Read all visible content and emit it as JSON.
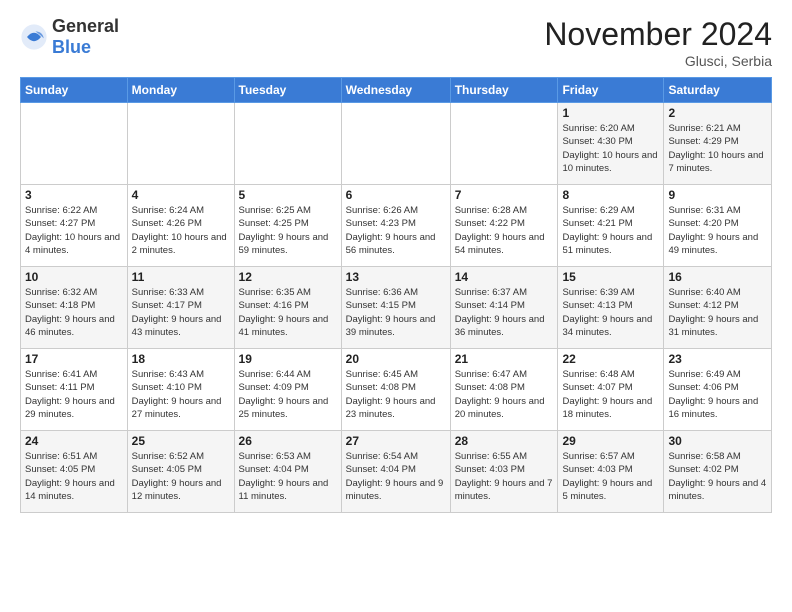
{
  "logo": {
    "general": "General",
    "blue": "Blue"
  },
  "title": "November 2024",
  "location": "Glusci, Serbia",
  "days_of_week": [
    "Sunday",
    "Monday",
    "Tuesday",
    "Wednesday",
    "Thursday",
    "Friday",
    "Saturday"
  ],
  "weeks": [
    [
      {
        "day": "",
        "info": ""
      },
      {
        "day": "",
        "info": ""
      },
      {
        "day": "",
        "info": ""
      },
      {
        "day": "",
        "info": ""
      },
      {
        "day": "",
        "info": ""
      },
      {
        "day": "1",
        "info": "Sunrise: 6:20 AM\nSunset: 4:30 PM\nDaylight: 10 hours and 10 minutes."
      },
      {
        "day": "2",
        "info": "Sunrise: 6:21 AM\nSunset: 4:29 PM\nDaylight: 10 hours and 7 minutes."
      }
    ],
    [
      {
        "day": "3",
        "info": "Sunrise: 6:22 AM\nSunset: 4:27 PM\nDaylight: 10 hours and 4 minutes."
      },
      {
        "day": "4",
        "info": "Sunrise: 6:24 AM\nSunset: 4:26 PM\nDaylight: 10 hours and 2 minutes."
      },
      {
        "day": "5",
        "info": "Sunrise: 6:25 AM\nSunset: 4:25 PM\nDaylight: 9 hours and 59 minutes."
      },
      {
        "day": "6",
        "info": "Sunrise: 6:26 AM\nSunset: 4:23 PM\nDaylight: 9 hours and 56 minutes."
      },
      {
        "day": "7",
        "info": "Sunrise: 6:28 AM\nSunset: 4:22 PM\nDaylight: 9 hours and 54 minutes."
      },
      {
        "day": "8",
        "info": "Sunrise: 6:29 AM\nSunset: 4:21 PM\nDaylight: 9 hours and 51 minutes."
      },
      {
        "day": "9",
        "info": "Sunrise: 6:31 AM\nSunset: 4:20 PM\nDaylight: 9 hours and 49 minutes."
      }
    ],
    [
      {
        "day": "10",
        "info": "Sunrise: 6:32 AM\nSunset: 4:18 PM\nDaylight: 9 hours and 46 minutes."
      },
      {
        "day": "11",
        "info": "Sunrise: 6:33 AM\nSunset: 4:17 PM\nDaylight: 9 hours and 43 minutes."
      },
      {
        "day": "12",
        "info": "Sunrise: 6:35 AM\nSunset: 4:16 PM\nDaylight: 9 hours and 41 minutes."
      },
      {
        "day": "13",
        "info": "Sunrise: 6:36 AM\nSunset: 4:15 PM\nDaylight: 9 hours and 39 minutes."
      },
      {
        "day": "14",
        "info": "Sunrise: 6:37 AM\nSunset: 4:14 PM\nDaylight: 9 hours and 36 minutes."
      },
      {
        "day": "15",
        "info": "Sunrise: 6:39 AM\nSunset: 4:13 PM\nDaylight: 9 hours and 34 minutes."
      },
      {
        "day": "16",
        "info": "Sunrise: 6:40 AM\nSunset: 4:12 PM\nDaylight: 9 hours and 31 minutes."
      }
    ],
    [
      {
        "day": "17",
        "info": "Sunrise: 6:41 AM\nSunset: 4:11 PM\nDaylight: 9 hours and 29 minutes."
      },
      {
        "day": "18",
        "info": "Sunrise: 6:43 AM\nSunset: 4:10 PM\nDaylight: 9 hours and 27 minutes."
      },
      {
        "day": "19",
        "info": "Sunrise: 6:44 AM\nSunset: 4:09 PM\nDaylight: 9 hours and 25 minutes."
      },
      {
        "day": "20",
        "info": "Sunrise: 6:45 AM\nSunset: 4:08 PM\nDaylight: 9 hours and 23 minutes."
      },
      {
        "day": "21",
        "info": "Sunrise: 6:47 AM\nSunset: 4:08 PM\nDaylight: 9 hours and 20 minutes."
      },
      {
        "day": "22",
        "info": "Sunrise: 6:48 AM\nSunset: 4:07 PM\nDaylight: 9 hours and 18 minutes."
      },
      {
        "day": "23",
        "info": "Sunrise: 6:49 AM\nSunset: 4:06 PM\nDaylight: 9 hours and 16 minutes."
      }
    ],
    [
      {
        "day": "24",
        "info": "Sunrise: 6:51 AM\nSunset: 4:05 PM\nDaylight: 9 hours and 14 minutes."
      },
      {
        "day": "25",
        "info": "Sunrise: 6:52 AM\nSunset: 4:05 PM\nDaylight: 9 hours and 12 minutes."
      },
      {
        "day": "26",
        "info": "Sunrise: 6:53 AM\nSunset: 4:04 PM\nDaylight: 9 hours and 11 minutes."
      },
      {
        "day": "27",
        "info": "Sunrise: 6:54 AM\nSunset: 4:04 PM\nDaylight: 9 hours and 9 minutes."
      },
      {
        "day": "28",
        "info": "Sunrise: 6:55 AM\nSunset: 4:03 PM\nDaylight: 9 hours and 7 minutes."
      },
      {
        "day": "29",
        "info": "Sunrise: 6:57 AM\nSunset: 4:03 PM\nDaylight: 9 hours and 5 minutes."
      },
      {
        "day": "30",
        "info": "Sunrise: 6:58 AM\nSunset: 4:02 PM\nDaylight: 9 hours and 4 minutes."
      }
    ]
  ]
}
